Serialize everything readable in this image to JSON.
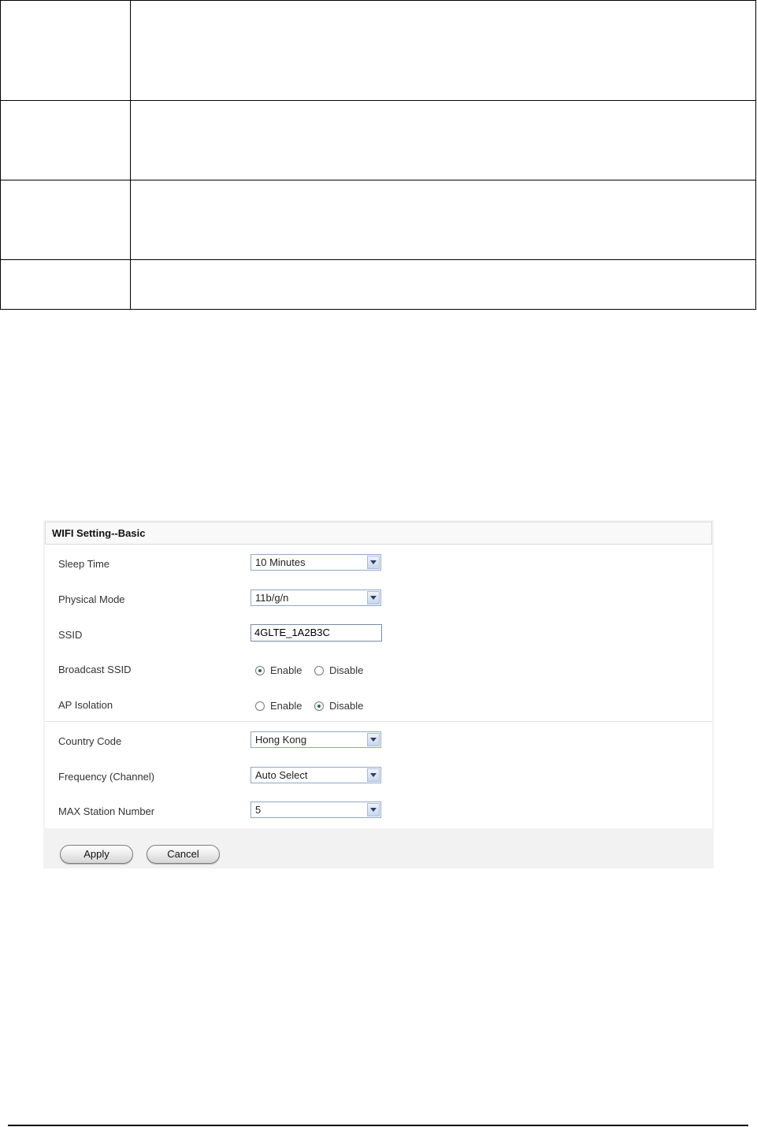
{
  "panel": {
    "title": "WIFI Setting--Basic"
  },
  "fields": {
    "sleep_time": {
      "label": "Sleep Time",
      "value": "10 Minutes"
    },
    "physical_mode": {
      "label": "Physical Mode",
      "value": "11b/g/n"
    },
    "ssid": {
      "label": "SSID",
      "value": "4GLTE_1A2B3C"
    },
    "broadcast_ssid": {
      "label": "Broadcast SSID",
      "options": [
        "Enable",
        "Disable"
      ],
      "selected": "Enable"
    },
    "ap_isolation": {
      "label": "AP Isolation",
      "options": [
        "Enable",
        "Disable"
      ],
      "selected": "Disable"
    },
    "country_code": {
      "label": "Country Code",
      "value": "Hong Kong"
    },
    "frequency": {
      "label": "Frequency (Channel)",
      "value": "Auto Select"
    },
    "max_station": {
      "label": "MAX Station Number",
      "value": "5"
    }
  },
  "buttons": {
    "apply": "Apply",
    "cancel": "Cancel"
  },
  "colors": {
    "panel_bg": "#f2f2f2",
    "select_border": "#8fa7c7",
    "radio_dot": "#2c6e2c"
  }
}
